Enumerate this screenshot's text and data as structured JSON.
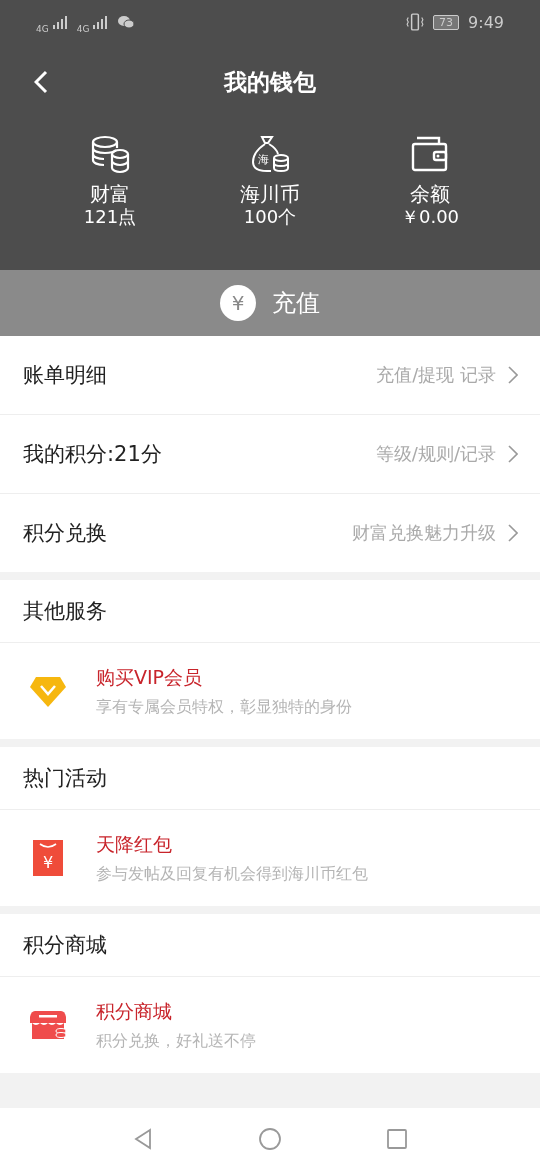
{
  "status_bar": {
    "network_1": "4G",
    "network_2": "4G",
    "battery": "73",
    "time": "9:49"
  },
  "header": {
    "title": "我的钱包"
  },
  "stats": [
    {
      "kind": "coins",
      "label": "财富",
      "value": "121点"
    },
    {
      "kind": "moneybag",
      "label": "海川币",
      "value": "100个",
      "icon_text": "海"
    },
    {
      "kind": "wallet",
      "label": "余额",
      "value": "￥0.00"
    }
  ],
  "recharge": {
    "icon": "¥",
    "label": "充值"
  },
  "menu": [
    {
      "label": "账单明细",
      "hint": "充值/提现 记录"
    },
    {
      "label": "我的积分:21分",
      "hint": "等级/规则/记录"
    },
    {
      "label": "积分兑换",
      "hint": "财富兑换魅力升级"
    }
  ],
  "sections": [
    {
      "title": "其他服务",
      "items": [
        {
          "kind": "vip",
          "title": "购买VIP会员",
          "subtitle": "享有专属会员特权，彰显独特的身份"
        }
      ]
    },
    {
      "title": "热门活动",
      "items": [
        {
          "kind": "redpacket",
          "title": "天降红包",
          "subtitle": "参与发帖及回复有机会得到海川币红包",
          "icon_text": "¥"
        }
      ]
    },
    {
      "title": "积分商城",
      "items": [
        {
          "kind": "shop",
          "title": "积分商城",
          "subtitle": "积分兑换，好礼送不停"
        }
      ]
    }
  ]
}
